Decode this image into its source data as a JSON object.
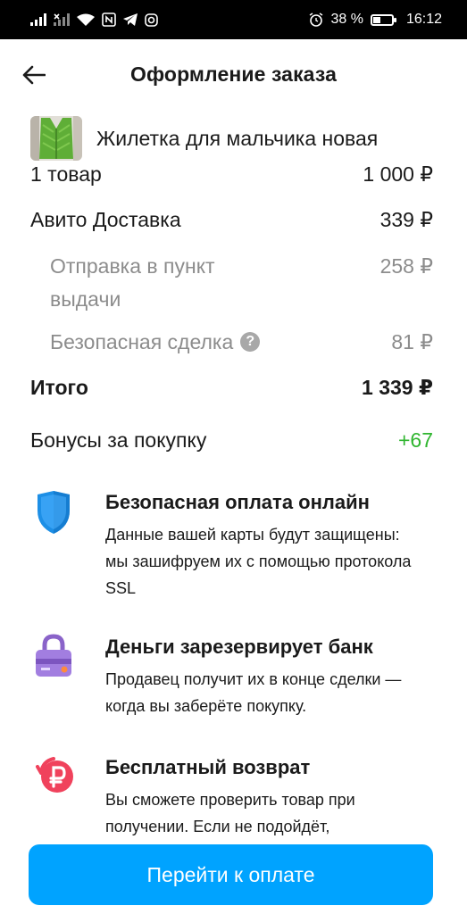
{
  "status_bar": {
    "battery": "38 %",
    "time": "16:12",
    "battery_level": 0.38
  },
  "header": {
    "title": "Оформление заказа"
  },
  "product": {
    "name": "Жилетка для мальчика новая"
  },
  "summary": {
    "items_label": "1 товар",
    "items_value": "1 000 ₽",
    "delivery_label": "Авито Доставка",
    "delivery_value": "339 ₽",
    "pickup_label": "Отправка в пункт выдачи",
    "pickup_value": "258 ₽",
    "safe_deal_label": "Безопасная сделка",
    "safe_deal_value": "81 ₽",
    "total_label": "Итого",
    "total_value": "1 339 ₽",
    "bonus_label": "Бонусы за покупку",
    "bonus_value": "+67"
  },
  "features": [
    {
      "title": "Безопасная оплата онлайн",
      "description": "Данные вашей карты будут защищены: мы зашифруем их с помощью протокола SSL",
      "icon": "shield-icon"
    },
    {
      "title": "Деньги зарезервирует банк",
      "description": "Продавец получит их в конце сделки — когда вы заберёте покупку.",
      "icon": "lock-card-icon"
    },
    {
      "title": "Бесплатный возврат",
      "description": "Вы сможете проверить товар при получении. Если не подойдёт,",
      "icon": "ruble-return-icon"
    }
  ],
  "pay_button": {
    "label": "Перейти к оплате"
  },
  "colors": {
    "accent": "#00a3ff",
    "bonus": "#2fb52f",
    "muted": "#8c8c8c"
  }
}
